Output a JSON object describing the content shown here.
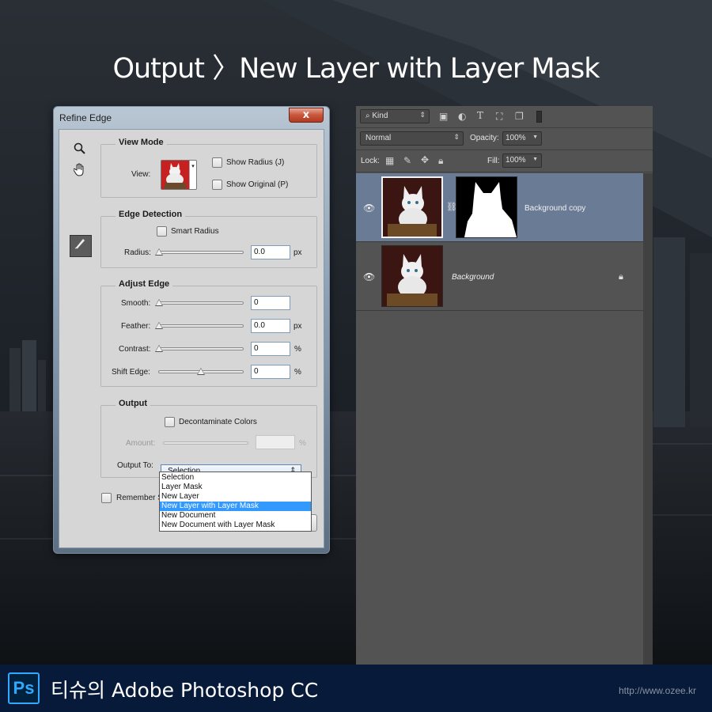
{
  "headline": "Output 〉New Layer with Layer Mask",
  "dialog": {
    "title": "Refine Edge",
    "close_label": "x",
    "view_mode": {
      "title": "View Mode",
      "view_label": "View:",
      "show_radius": "Show Radius (J)",
      "show_original": "Show Original (P)"
    },
    "edge_detection": {
      "title": "Edge Detection",
      "smart_radius": "Smart Radius",
      "radius_label": "Radius:",
      "radius_value": "0.0",
      "radius_unit": "px"
    },
    "adjust_edge": {
      "title": "Adjust Edge",
      "smooth_label": "Smooth:",
      "smooth_value": "0",
      "feather_label": "Feather:",
      "feather_value": "0.0",
      "feather_unit": "px",
      "contrast_label": "Contrast:",
      "contrast_value": "0",
      "contrast_unit": "%",
      "shift_label": "Shift Edge:",
      "shift_value": "0",
      "shift_unit": "%"
    },
    "output": {
      "title": "Output",
      "decontaminate": "Decontaminate Colors",
      "amount_label": "Amount:",
      "amount_unit": "%",
      "output_to_label": "Output To:",
      "output_to_value": "Selection",
      "options": [
        "Selection",
        "Layer Mask",
        "New Layer",
        "New Layer with Layer Mask",
        "New Document",
        "New Document with Layer Mask"
      ],
      "selected_option": "New Layer with Layer Mask"
    },
    "remember_label": "Remember S"
  },
  "layers_panel": {
    "filter_kind": "Kind",
    "blend_mode": "Normal",
    "opacity_label": "Opacity:",
    "opacity_value": "100%",
    "lock_label": "Lock:",
    "fill_label": "Fill:",
    "fill_value": "100%",
    "layers": [
      {
        "name": "Background copy",
        "selected": true,
        "has_mask": true
      },
      {
        "name": "Background",
        "selected": false,
        "locked": true
      }
    ]
  },
  "footer": {
    "logo": "Ps",
    "title": "티슈의 Adobe Photoshop CC",
    "url": "http://www.ozee.kr"
  },
  "colors": {
    "selected_layer": "#6a7b95",
    "dropdown_highlight": "#3399ff",
    "footer_bg": "#071a3a",
    "ps_blue": "#31a8ff"
  }
}
